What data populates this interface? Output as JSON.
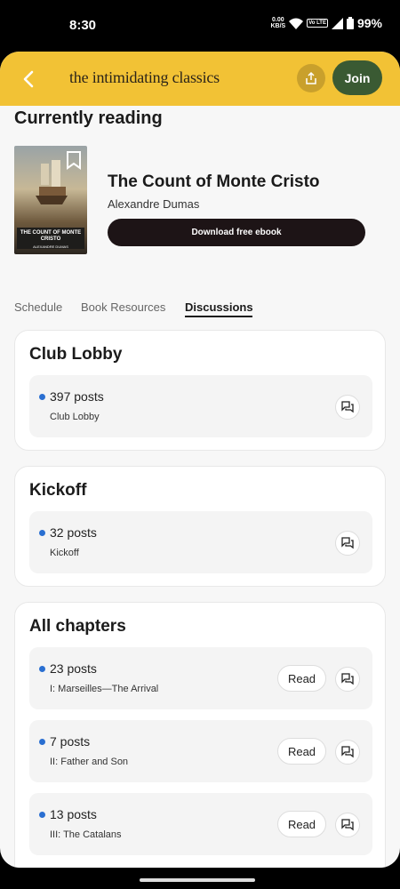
{
  "status": {
    "time": "8:30",
    "speed_value": "0.00",
    "speed_unit": "KB/S",
    "lte": "Vo LTE",
    "battery": "99%"
  },
  "header": {
    "brand": "the intimidating classics",
    "join_label": "Join",
    "accent": "#f2c235",
    "join_color": "#3a5a33"
  },
  "reading": {
    "section_title": "Currently reading",
    "book_title": "The Count of Monte Cristo",
    "author": "Alexandre Dumas",
    "download_label": "Download free ebook",
    "cover_title": "THE COUNT OF MONTE CRISTO",
    "cover_author": "ALEXANDRE DUMAS"
  },
  "tabs": [
    {
      "label": "Schedule",
      "active": false
    },
    {
      "label": "Book Resources",
      "active": false
    },
    {
      "label": "Discussions",
      "active": true
    }
  ],
  "sections": [
    {
      "title": "Club Lobby",
      "items": [
        {
          "posts": "397 posts",
          "subtitle": "Club Lobby"
        }
      ]
    },
    {
      "title": "Kickoff",
      "items": [
        {
          "posts": "32 posts",
          "subtitle": "Kickoff"
        }
      ]
    },
    {
      "title": "All chapters",
      "read_label": "Read",
      "items": [
        {
          "posts": "23 posts",
          "subtitle": "I: Marseilles—The Arrival"
        },
        {
          "posts": "7 posts",
          "subtitle": "II: Father and Son"
        },
        {
          "posts": "13 posts",
          "subtitle": "III: The Catalans"
        }
      ]
    }
  ],
  "icons": {
    "back": "chevron-left-icon",
    "share": "share-icon",
    "bookmark": "bookmark-icon",
    "chat": "chat-bubbles-icon",
    "unread": "unread-dot"
  },
  "colors": {
    "unread_dot": "#2a6fd1"
  }
}
